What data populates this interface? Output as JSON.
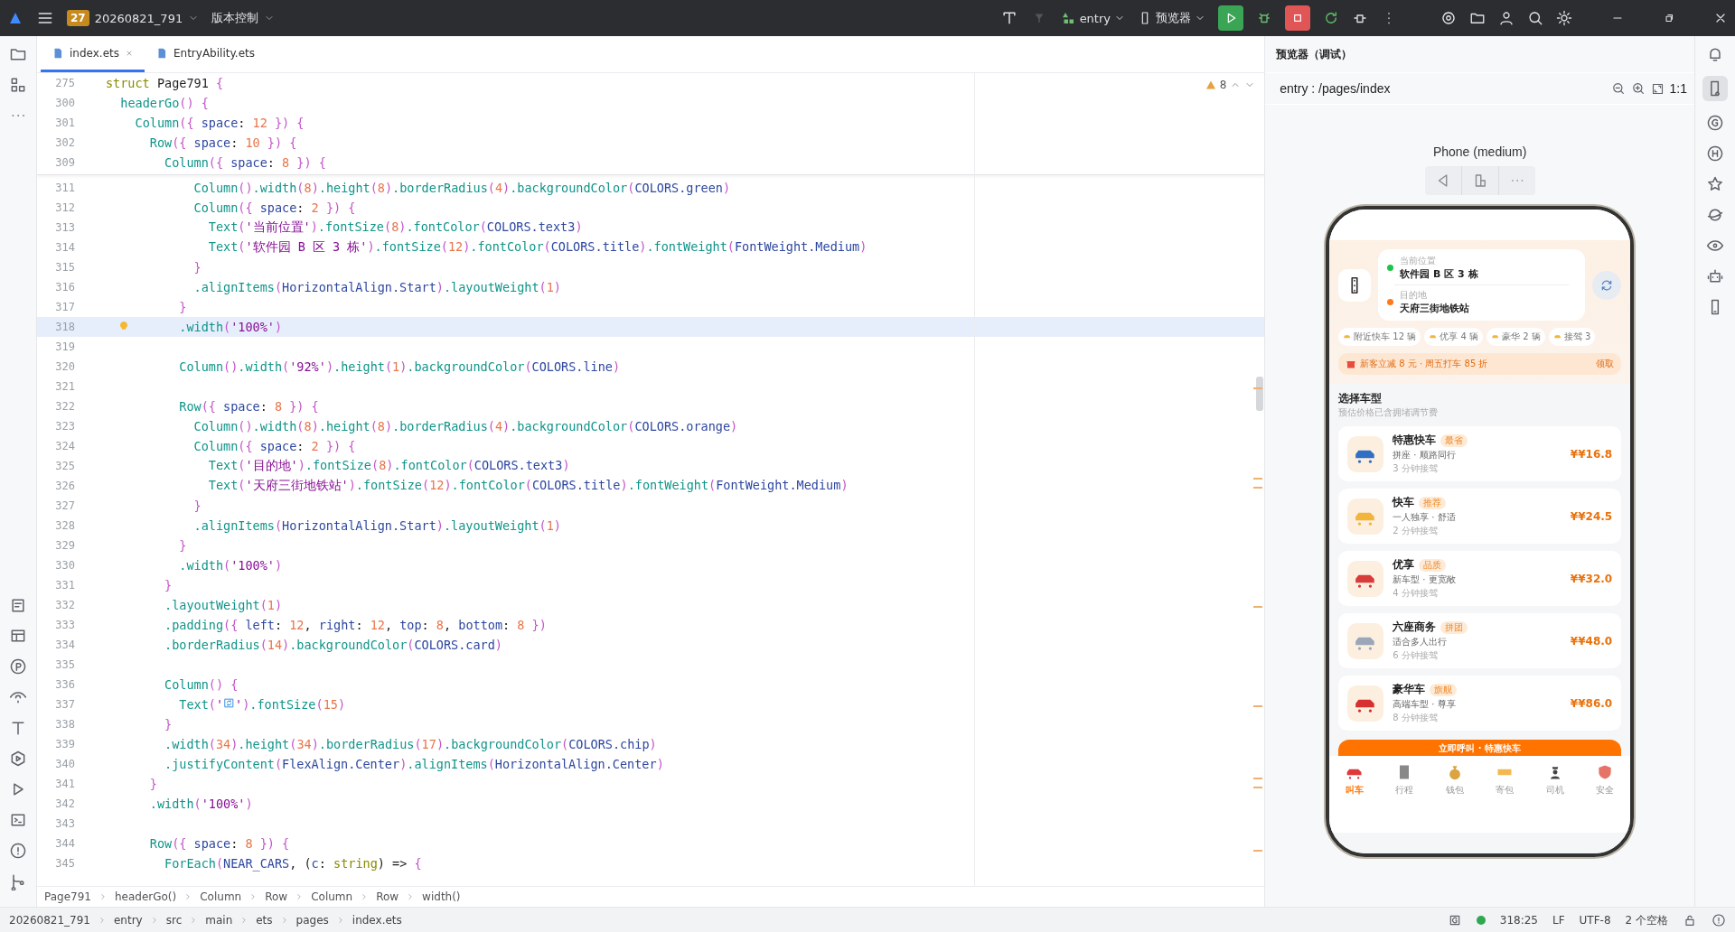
{
  "toolbar": {
    "project_badge": "27",
    "project": "20260821_791",
    "vcs": "版本控制",
    "module": "entry",
    "device": "预览器"
  },
  "editor_tabs": [
    {
      "label": "index.ets",
      "selected": true
    },
    {
      "label": "EntryAbility.ets",
      "selected": false
    }
  ],
  "editor": {
    "warnings": "8",
    "sticky_lines": [
      {
        "num": "275",
        "segs": [
          {
            "kind": "keyword",
            "text": "struct "
          },
          {
            "kind": "plain",
            "text": "Page791 "
          },
          {
            "kind": "brace",
            "text": "{"
          }
        ]
      },
      {
        "num": "300",
        "segs": [
          {
            "kind": "fn",
            "text": "  headerGo"
          },
          {
            "kind": "brace",
            "text": "() {"
          }
        ]
      },
      {
        "num": "301",
        "segs": [
          {
            "kind": "fn",
            "text": "    Column"
          },
          {
            "kind": "brace",
            "text": "({ "
          },
          {
            "kind": "ident",
            "text": "space"
          },
          {
            "kind": "plain",
            "text": ": "
          },
          {
            "kind": "number",
            "text": "12"
          },
          {
            "kind": "brace",
            "text": " }) {"
          }
        ]
      },
      {
        "num": "302",
        "segs": [
          {
            "kind": "fn",
            "text": "      Row"
          },
          {
            "kind": "brace",
            "text": "({ "
          },
          {
            "kind": "ident",
            "text": "space"
          },
          {
            "kind": "plain",
            "text": ": "
          },
          {
            "kind": "number",
            "text": "10"
          },
          {
            "kind": "brace",
            "text": " }) {"
          }
        ]
      },
      {
        "num": "309",
        "segs": [
          {
            "kind": "fn",
            "text": "        Column"
          },
          {
            "kind": "brace",
            "text": "({ "
          },
          {
            "kind": "ident",
            "text": "space"
          },
          {
            "kind": "plain",
            "text": ": "
          },
          {
            "kind": "number",
            "text": "8"
          },
          {
            "kind": "brace",
            "text": " }) {"
          }
        ]
      }
    ],
    "lines": [
      {
        "num": "311",
        "current": false,
        "segs": [
          {
            "kind": "fn",
            "text": "            Column"
          },
          {
            "kind": "brace",
            "text": "()"
          },
          {
            "kind": "fn",
            "text": ".width"
          },
          {
            "kind": "brace",
            "text": "("
          },
          {
            "kind": "number",
            "text": "8"
          },
          {
            "kind": "brace",
            "text": ")"
          },
          {
            "kind": "fn",
            "text": ".height"
          },
          {
            "kind": "brace",
            "text": "("
          },
          {
            "kind": "number",
            "text": "8"
          },
          {
            "kind": "brace",
            "text": ")"
          },
          {
            "kind": "fn",
            "text": ".borderRadius"
          },
          {
            "kind": "brace",
            "text": "("
          },
          {
            "kind": "number",
            "text": "4"
          },
          {
            "kind": "brace",
            "text": ")"
          },
          {
            "kind": "fn",
            "text": ".backgroundColor"
          },
          {
            "kind": "brace",
            "text": "("
          },
          {
            "kind": "ident",
            "text": "COLORS.green"
          },
          {
            "kind": "brace",
            "text": ")"
          }
        ]
      },
      {
        "num": "312",
        "current": false,
        "segs": [
          {
            "kind": "fn",
            "text": "            Column"
          },
          {
            "kind": "brace",
            "text": "({ "
          },
          {
            "kind": "ident",
            "text": "space"
          },
          {
            "kind": "plain",
            "text": ": "
          },
          {
            "kind": "number",
            "text": "2"
          },
          {
            "kind": "brace",
            "text": " }) {"
          }
        ]
      },
      {
        "num": "313",
        "current": false,
        "segs": [
          {
            "kind": "fn",
            "text": "              Text"
          },
          {
            "kind": "brace",
            "text": "("
          },
          {
            "kind": "string",
            "text": "'当前位置'"
          },
          {
            "kind": "brace",
            "text": ")"
          },
          {
            "kind": "fn",
            "text": ".fontSize"
          },
          {
            "kind": "brace",
            "text": "("
          },
          {
            "kind": "number",
            "text": "8"
          },
          {
            "kind": "brace",
            "text": ")"
          },
          {
            "kind": "fn",
            "text": ".fontColor"
          },
          {
            "kind": "brace",
            "text": "("
          },
          {
            "kind": "ident",
            "text": "COLORS.text3"
          },
          {
            "kind": "brace",
            "text": ")"
          }
        ]
      },
      {
        "num": "314",
        "current": false,
        "segs": [
          {
            "kind": "fn",
            "text": "              Text"
          },
          {
            "kind": "brace",
            "text": "("
          },
          {
            "kind": "string",
            "text": "'软件园 B 区 3 栋'"
          },
          {
            "kind": "brace",
            "text": ")"
          },
          {
            "kind": "fn",
            "text": ".fontSize"
          },
          {
            "kind": "brace",
            "text": "("
          },
          {
            "kind": "number",
            "text": "12"
          },
          {
            "kind": "brace",
            "text": ")"
          },
          {
            "kind": "fn",
            "text": ".fontColor"
          },
          {
            "kind": "brace",
            "text": "("
          },
          {
            "kind": "ident",
            "text": "COLORS.title"
          },
          {
            "kind": "brace",
            "text": ")"
          },
          {
            "kind": "fn",
            "text": ".fontWeight"
          },
          {
            "kind": "brace",
            "text": "("
          },
          {
            "kind": "ident",
            "text": "FontWeight.Medium"
          },
          {
            "kind": "brace",
            "text": ")"
          }
        ]
      },
      {
        "num": "315",
        "current": false,
        "segs": [
          {
            "kind": "brace",
            "text": "            }"
          }
        ]
      },
      {
        "num": "316",
        "current": false,
        "segs": [
          {
            "kind": "fn",
            "text": "            .alignItems"
          },
          {
            "kind": "brace",
            "text": "("
          },
          {
            "kind": "ident",
            "text": "HorizontalAlign.Start"
          },
          {
            "kind": "brace",
            "text": ")"
          },
          {
            "kind": "fn",
            "text": ".layoutWeight"
          },
          {
            "kind": "brace",
            "text": "("
          },
          {
            "kind": "number",
            "text": "1"
          },
          {
            "kind": "brace",
            "text": ")"
          }
        ]
      },
      {
        "num": "317",
        "current": false,
        "segs": [
          {
            "kind": "brace",
            "text": "          }"
          }
        ]
      },
      {
        "num": "318",
        "current": true,
        "segs": [
          {
            "kind": "fn",
            "text": "          .width"
          },
          {
            "kind": "brace",
            "text": "("
          },
          {
            "kind": "string",
            "text": "'100%'"
          },
          {
            "kind": "brace",
            "text": ")"
          }
        ]
      },
      {
        "num": "319",
        "current": false
      },
      {
        "num": "320",
        "current": false,
        "segs": [
          {
            "kind": "fn",
            "text": "          Column"
          },
          {
            "kind": "brace",
            "text": "()"
          },
          {
            "kind": "fn",
            "text": ".width"
          },
          {
            "kind": "brace",
            "text": "("
          },
          {
            "kind": "string",
            "text": "'92%'"
          },
          {
            "kind": "brace",
            "text": ")"
          },
          {
            "kind": "fn",
            "text": ".height"
          },
          {
            "kind": "brace",
            "text": "("
          },
          {
            "kind": "number",
            "text": "1"
          },
          {
            "kind": "brace",
            "text": ")"
          },
          {
            "kind": "fn",
            "text": ".backgroundColor"
          },
          {
            "kind": "brace",
            "text": "("
          },
          {
            "kind": "ident",
            "text": "COLORS.line"
          },
          {
            "kind": "brace",
            "text": ")"
          }
        ]
      },
      {
        "num": "321",
        "current": false
      },
      {
        "num": "322",
        "current": false,
        "segs": [
          {
            "kind": "fn",
            "text": "          Row"
          },
          {
            "kind": "brace",
            "text": "({ "
          },
          {
            "kind": "ident",
            "text": "space"
          },
          {
            "kind": "plain",
            "text": ": "
          },
          {
            "kind": "number",
            "text": "8"
          },
          {
            "kind": "brace",
            "text": " }) {"
          }
        ]
      },
      {
        "num": "323",
        "current": false,
        "segs": [
          {
            "kind": "fn",
            "text": "            Column"
          },
          {
            "kind": "brace",
            "text": "()"
          },
          {
            "kind": "fn",
            "text": ".width"
          },
          {
            "kind": "brace",
            "text": "("
          },
          {
            "kind": "number",
            "text": "8"
          },
          {
            "kind": "brace",
            "text": ")"
          },
          {
            "kind": "fn",
            "text": ".height"
          },
          {
            "kind": "brace",
            "text": "("
          },
          {
            "kind": "number",
            "text": "8"
          },
          {
            "kind": "brace",
            "text": ")"
          },
          {
            "kind": "fn",
            "text": ".borderRadius"
          },
          {
            "kind": "brace",
            "text": "("
          },
          {
            "kind": "number",
            "text": "4"
          },
          {
            "kind": "brace",
            "text": ")"
          },
          {
            "kind": "fn",
            "text": ".backgroundColor"
          },
          {
            "kind": "brace",
            "text": "("
          },
          {
            "kind": "ident",
            "text": "COLORS.orange"
          },
          {
            "kind": "brace",
            "text": ")"
          }
        ]
      },
      {
        "num": "324",
        "current": false,
        "segs": [
          {
            "kind": "fn",
            "text": "            Column"
          },
          {
            "kind": "brace",
            "text": "({ "
          },
          {
            "kind": "ident",
            "text": "space"
          },
          {
            "kind": "plain",
            "text": ": "
          },
          {
            "kind": "number",
            "text": "2"
          },
          {
            "kind": "brace",
            "text": " }) {"
          }
        ]
      },
      {
        "num": "325",
        "current": false,
        "segs": [
          {
            "kind": "fn",
            "text": "              Text"
          },
          {
            "kind": "brace",
            "text": "("
          },
          {
            "kind": "string",
            "text": "'目的地'"
          },
          {
            "kind": "brace",
            "text": ")"
          },
          {
            "kind": "fn",
            "text": ".fontSize"
          },
          {
            "kind": "brace",
            "text": "("
          },
          {
            "kind": "number",
            "text": "8"
          },
          {
            "kind": "brace",
            "text": ")"
          },
          {
            "kind": "fn",
            "text": ".fontColor"
          },
          {
            "kind": "brace",
            "text": "("
          },
          {
            "kind": "ident",
            "text": "COLORS.text3"
          },
          {
            "kind": "brace",
            "text": ")"
          }
        ]
      },
      {
        "num": "326",
        "current": false,
        "segs": [
          {
            "kind": "fn",
            "text": "              Text"
          },
          {
            "kind": "brace",
            "text": "("
          },
          {
            "kind": "string",
            "text": "'天府三街地铁站'"
          },
          {
            "kind": "brace",
            "text": ")"
          },
          {
            "kind": "fn",
            "text": ".fontSize"
          },
          {
            "kind": "brace",
            "text": "("
          },
          {
            "kind": "number",
            "text": "12"
          },
          {
            "kind": "brace",
            "text": ")"
          },
          {
            "kind": "fn",
            "text": ".fontColor"
          },
          {
            "kind": "brace",
            "text": "("
          },
          {
            "kind": "ident",
            "text": "COLORS.title"
          },
          {
            "kind": "brace",
            "text": ")"
          },
          {
            "kind": "fn",
            "text": ".fontWeight"
          },
          {
            "kind": "brace",
            "text": "("
          },
          {
            "kind": "ident",
            "text": "FontWeight.Medium"
          },
          {
            "kind": "brace",
            "text": ")"
          }
        ]
      },
      {
        "num": "327",
        "current": false,
        "segs": [
          {
            "kind": "brace",
            "text": "            }"
          }
        ]
      },
      {
        "num": "328",
        "current": false,
        "segs": [
          {
            "kind": "fn",
            "text": "            .alignItems"
          },
          {
            "kind": "brace",
            "text": "("
          },
          {
            "kind": "ident",
            "text": "HorizontalAlign.Start"
          },
          {
            "kind": "brace",
            "text": ")"
          },
          {
            "kind": "fn",
            "text": ".layoutWeight"
          },
          {
            "kind": "brace",
            "text": "("
          },
          {
            "kind": "number",
            "text": "1"
          },
          {
            "kind": "brace",
            "text": ")"
          }
        ]
      },
      {
        "num": "329",
        "current": false,
        "segs": [
          {
            "kind": "brace",
            "text": "          }"
          }
        ]
      },
      {
        "num": "330",
        "current": false,
        "segs": [
          {
            "kind": "fn",
            "text": "          .width"
          },
          {
            "kind": "brace",
            "text": "("
          },
          {
            "kind": "string",
            "text": "'100%'"
          },
          {
            "kind": "brace",
            "text": ")"
          }
        ]
      },
      {
        "num": "331",
        "current": false,
        "segs": [
          {
            "kind": "brace",
            "text": "        }"
          }
        ]
      },
      {
        "num": "332",
        "current": false,
        "segs": [
          {
            "kind": "fn",
            "text": "        .layoutWeight"
          },
          {
            "kind": "brace",
            "text": "("
          },
          {
            "kind": "number",
            "text": "1"
          },
          {
            "kind": "brace",
            "text": ")"
          }
        ]
      },
      {
        "num": "333",
        "current": false,
        "segs": [
          {
            "kind": "fn",
            "text": "        .padding"
          },
          {
            "kind": "brace",
            "text": "({ "
          },
          {
            "kind": "ident",
            "text": "left"
          },
          {
            "kind": "plain",
            "text": ": "
          },
          {
            "kind": "number",
            "text": "12"
          },
          {
            "kind": "plain",
            "text": ", "
          },
          {
            "kind": "ident",
            "text": "right"
          },
          {
            "kind": "plain",
            "text": ": "
          },
          {
            "kind": "number",
            "text": "12"
          },
          {
            "kind": "plain",
            "text": ", "
          },
          {
            "kind": "ident",
            "text": "top"
          },
          {
            "kind": "plain",
            "text": ": "
          },
          {
            "kind": "number",
            "text": "8"
          },
          {
            "kind": "plain",
            "text": ", "
          },
          {
            "kind": "ident",
            "text": "bottom"
          },
          {
            "kind": "plain",
            "text": ": "
          },
          {
            "kind": "number",
            "text": "8"
          },
          {
            "kind": "brace",
            "text": " })"
          }
        ]
      },
      {
        "num": "334",
        "current": false,
        "segs": [
          {
            "kind": "fn",
            "text": "        .borderRadius"
          },
          {
            "kind": "brace",
            "text": "("
          },
          {
            "kind": "number",
            "text": "14"
          },
          {
            "kind": "brace",
            "text": ")"
          },
          {
            "kind": "fn",
            "text": ".backgroundColor"
          },
          {
            "kind": "brace",
            "text": "("
          },
          {
            "kind": "ident",
            "text": "COLORS.card"
          },
          {
            "kind": "brace",
            "text": ")"
          }
        ]
      },
      {
        "num": "335",
        "current": false
      },
      {
        "num": "336",
        "current": false,
        "segs": [
          {
            "kind": "fn",
            "text": "        Column"
          },
          {
            "kind": "brace",
            "text": "() {"
          }
        ]
      },
      {
        "num": "337",
        "current": false,
        "segs": [
          {
            "kind": "fn",
            "text": "          Text"
          },
          {
            "kind": "brace",
            "text": "("
          },
          {
            "kind": "string",
            "text": "'"
          },
          {
            "kind": "icon"
          },
          {
            "kind": "string",
            "text": "'"
          },
          {
            "kind": "brace",
            "text": ")"
          },
          {
            "kind": "fn",
            "text": ".fontSize"
          },
          {
            "kind": "brace",
            "text": "("
          },
          {
            "kind": "number",
            "text": "15"
          },
          {
            "kind": "brace",
            "text": ")"
          }
        ]
      },
      {
        "num": "338",
        "current": false,
        "segs": [
          {
            "kind": "brace",
            "text": "        }"
          }
        ]
      },
      {
        "num": "339",
        "current": false,
        "segs": [
          {
            "kind": "fn",
            "text": "        .width"
          },
          {
            "kind": "brace",
            "text": "("
          },
          {
            "kind": "number",
            "text": "34"
          },
          {
            "kind": "brace",
            "text": ")"
          },
          {
            "kind": "fn",
            "text": ".height"
          },
          {
            "kind": "brace",
            "text": "("
          },
          {
            "kind": "number",
            "text": "34"
          },
          {
            "kind": "brace",
            "text": ")"
          },
          {
            "kind": "fn",
            "text": ".borderRadius"
          },
          {
            "kind": "brace",
            "text": "("
          },
          {
            "kind": "number",
            "text": "17"
          },
          {
            "kind": "brace",
            "text": ")"
          },
          {
            "kind": "fn",
            "text": ".backgroundColor"
          },
          {
            "kind": "brace",
            "text": "("
          },
          {
            "kind": "ident",
            "text": "COLORS.chip"
          },
          {
            "kind": "brace",
            "text": ")"
          }
        ]
      },
      {
        "num": "340",
        "current": false,
        "segs": [
          {
            "kind": "fn",
            "text": "        .justifyContent"
          },
          {
            "kind": "brace",
            "text": "("
          },
          {
            "kind": "ident",
            "text": "FlexAlign.Center"
          },
          {
            "kind": "brace",
            "text": ")"
          },
          {
            "kind": "fn",
            "text": ".alignItems"
          },
          {
            "kind": "brace",
            "text": "("
          },
          {
            "kind": "ident",
            "text": "HorizontalAlign.Center"
          },
          {
            "kind": "brace",
            "text": ")"
          }
        ]
      },
      {
        "num": "341",
        "current": false,
        "segs": [
          {
            "kind": "brace",
            "text": "      }"
          }
        ]
      },
      {
        "num": "342",
        "current": false,
        "segs": [
          {
            "kind": "fn",
            "text": "      .width"
          },
          {
            "kind": "brace",
            "text": "("
          },
          {
            "kind": "string",
            "text": "'100%'"
          },
          {
            "kind": "brace",
            "text": ")"
          }
        ]
      },
      {
        "num": "343",
        "current": false
      },
      {
        "num": "344",
        "current": false,
        "segs": [
          {
            "kind": "fn",
            "text": "      Row"
          },
          {
            "kind": "brace",
            "text": "({ "
          },
          {
            "kind": "ident",
            "text": "space"
          },
          {
            "kind": "plain",
            "text": ": "
          },
          {
            "kind": "number",
            "text": "8"
          },
          {
            "kind": "brace",
            "text": " }) {"
          }
        ]
      },
      {
        "num": "345",
        "current": false,
        "segs": [
          {
            "kind": "fn",
            "text": "        ForEach"
          },
          {
            "kind": "brace",
            "text": "("
          },
          {
            "kind": "ident",
            "text": "NEAR_CARS"
          },
          {
            "kind": "plain",
            "text": ", ("
          },
          {
            "kind": "ident",
            "text": "c"
          },
          {
            "kind": "plain",
            "text": ": "
          },
          {
            "kind": "keyword",
            "text": "string"
          },
          {
            "kind": "plain",
            "text": ") => "
          },
          {
            "kind": "brace",
            "text": "{"
          }
        ]
      }
    ]
  },
  "breadcrumb": [
    "Page791",
    "headerGo()",
    "Column",
    "Row",
    "Column",
    "Row",
    "width()"
  ],
  "preview": {
    "title": "预览器（调试）",
    "route": "entry : /pages/index",
    "zoom_reset": "1:1",
    "device": "Phone (medium)",
    "app": {
      "from_label": "当前位置",
      "from": "软件园 B 区 3 栋",
      "to_label": "目的地",
      "to": "天府三街地铁站",
      "chips": [
        "附近快车 12 辆",
        "优享 4 辆",
        "豪华 2 辆",
        "接驾 3"
      ],
      "promo": {
        "text": "新客立减 8 元 · 周五打车 85 折",
        "action": "领取"
      },
      "section_title": "选择车型",
      "section_subtitle": "预估价格已含拥堵调节费",
      "cars": [
        {
          "name": "特惠快车",
          "tag": "最省",
          "desc": "拼座 · 顺路同行",
          "eta": "3 分钟接驾",
          "price": "¥¥16.8"
        },
        {
          "name": "快车",
          "tag": "推荐",
          "desc": "一人独享 · 舒适",
          "eta": "2 分钟接驾",
          "price": "¥¥24.5"
        },
        {
          "name": "优享",
          "tag": "品质",
          "desc": "新车型 · 更宽敞",
          "eta": "4 分钟接驾",
          "price": "¥¥32.0"
        },
        {
          "name": "六座商务",
          "tag": "拼团",
          "desc": "适合多人出行",
          "eta": "6 分钟接驾",
          "price": "¥¥48.0"
        },
        {
          "name": "豪华车",
          "tag": "旗舰",
          "desc": "高端车型 · 尊享",
          "eta": "8 分钟接驾",
          "price": "¥¥86.0"
        }
      ],
      "call_button": "立即呼叫 · 特惠快车",
      "tabs": [
        {
          "label": "叫车",
          "selected": true
        },
        {
          "label": "行程",
          "selected": false
        },
        {
          "label": "钱包",
          "selected": false
        },
        {
          "label": "寄包",
          "selected": false
        },
        {
          "label": "司机",
          "selected": false
        },
        {
          "label": "安全",
          "selected": false
        }
      ]
    }
  },
  "status_bar": {
    "path": [
      "20260821_791",
      "entry",
      "src",
      "main",
      "ets",
      "pages",
      "index.ets"
    ],
    "position": "318:25",
    "line_ending": "LF",
    "encoding": "UTF-8",
    "indent": "2 个空格"
  }
}
